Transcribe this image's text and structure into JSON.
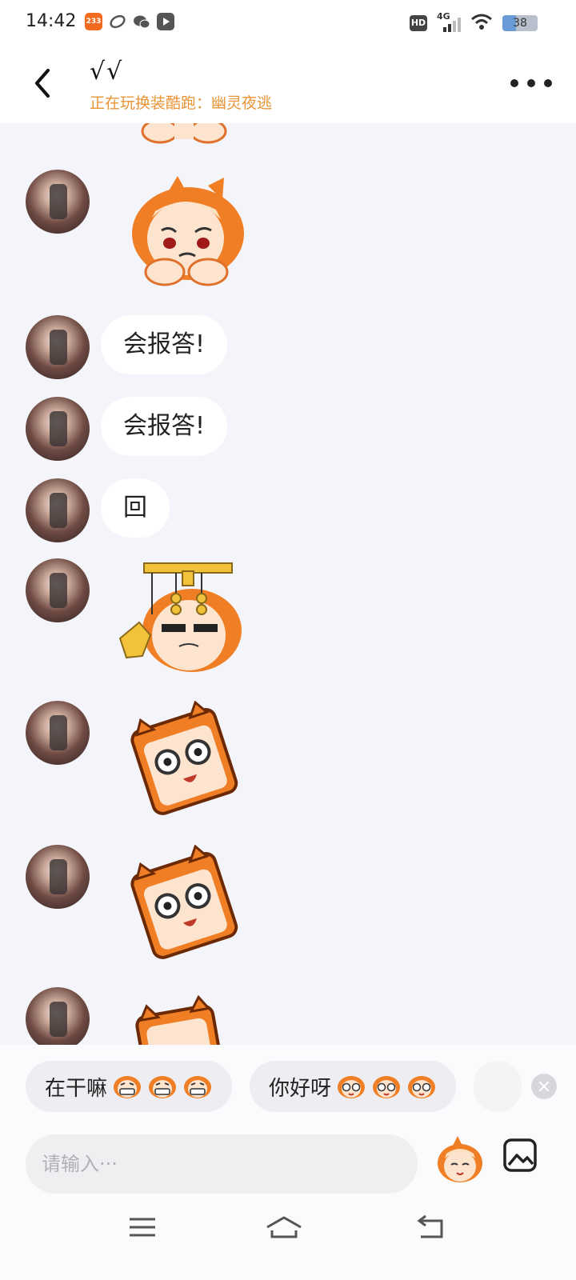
{
  "status_bar": {
    "time": "14:42",
    "app_badge": "233",
    "hd": "HD",
    "network": "4G",
    "battery": "38",
    "battery_level": 0.38
  },
  "header": {
    "title": "√√",
    "subtitle": "正在玩换装酷跑：幽灵夜逃"
  },
  "messages": [
    {
      "type": "sticker",
      "sticker": "chibi-sad-face"
    },
    {
      "type": "text",
      "text": "会报答!"
    },
    {
      "type": "text",
      "text": "会报答!"
    },
    {
      "type": "text",
      "text": "回"
    },
    {
      "type": "sticker",
      "sticker": "chibi-ok-gesture"
    },
    {
      "type": "sticker",
      "sticker": "chibi-tilted-glasses"
    },
    {
      "type": "sticker",
      "sticker": "chibi-tilted-glasses"
    },
    {
      "type": "sticker",
      "sticker": "chibi-partial"
    }
  ],
  "quick_replies": [
    {
      "label": "在干嘛",
      "emoji": "grin-face",
      "emoji_count": 3
    },
    {
      "label": "你好呀",
      "emoji": "glasses-face",
      "emoji_count": 3
    }
  ],
  "input": {
    "placeholder": "请输入···"
  },
  "colors": {
    "accent_orange": "#f07e24",
    "subtitle_orange": "#e89436",
    "chat_background": "#f4f5fa",
    "bubble": "#ffffff"
  },
  "icons": {
    "back": "back-arrow-icon",
    "more": "more-dots-icon",
    "emoji": "chibi-emoji-icon",
    "image": "image-icon",
    "nav_menu": "menu-lines-icon",
    "nav_home": "home-icon",
    "nav_back": "return-icon"
  }
}
